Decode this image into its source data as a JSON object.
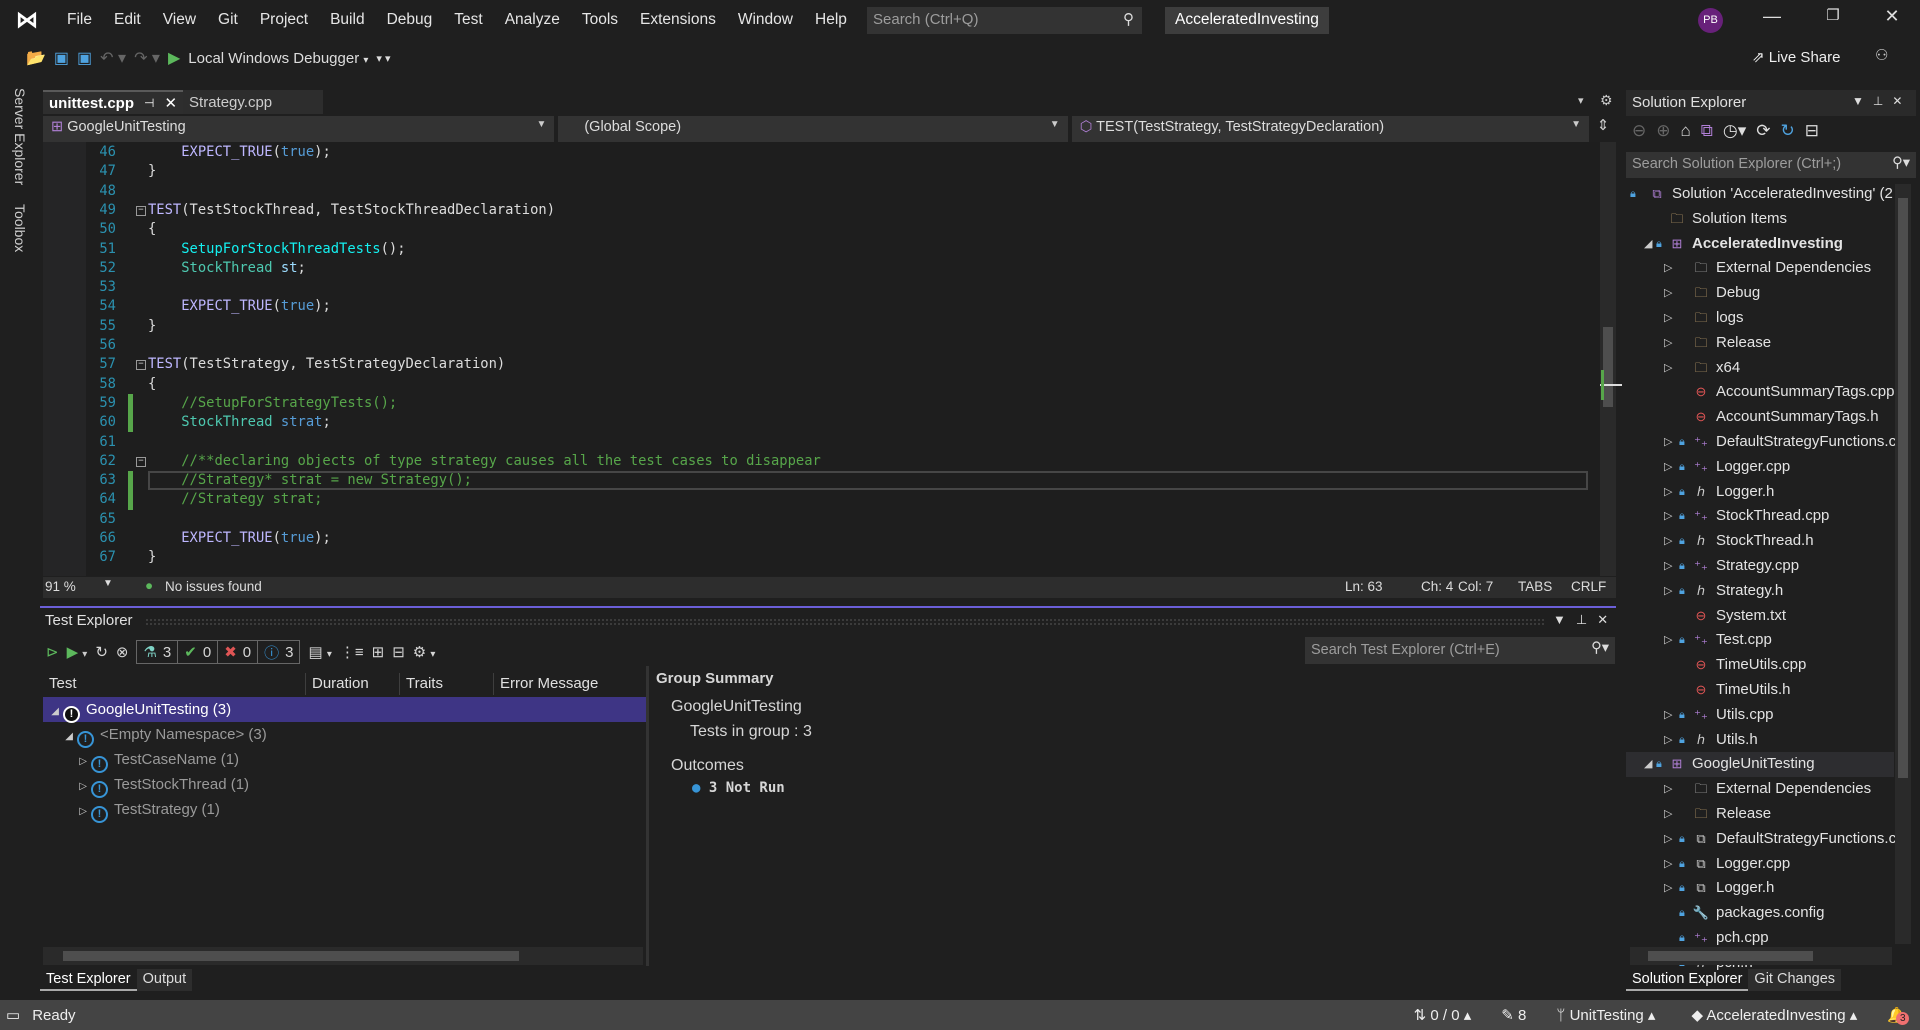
{
  "menu": {
    "items": [
      "File",
      "Edit",
      "View",
      "Git",
      "Project",
      "Build",
      "Debug",
      "Test",
      "Analyze",
      "Tools",
      "Extensions",
      "Window",
      "Help"
    ],
    "search_placeholder": "Search (Ctrl+Q)",
    "solution_name": "AcceleratedInvesting",
    "avatar": "PB"
  },
  "toolbar": {
    "debugger": "Local Windows Debugger",
    "live_share": "Live Share"
  },
  "side_tabs": [
    "Server Explorer",
    "Toolbox"
  ],
  "doc_tabs": [
    {
      "label": "unittest.cpp",
      "active": true
    },
    {
      "label": "Strategy.cpp",
      "active": false
    }
  ],
  "navbar": {
    "project": "GoogleUnitTesting",
    "scope": "(Global Scope)",
    "member": "TEST(TestStrategy, TestStrategyDeclaration)"
  },
  "code_lines": [
    {
      "n": "46",
      "segs": [
        [
          "mac",
          "    EXPECT_TRUE"
        ],
        [
          "p",
          "("
        ],
        [
          "kw",
          "true"
        ],
        [
          "p",
          ");"
        ]
      ]
    },
    {
      "n": "47",
      "segs": [
        [
          "p",
          "}"
        ]
      ]
    },
    {
      "n": "48",
      "segs": []
    },
    {
      "n": "49",
      "fold": true,
      "segs": [
        [
          "mac",
          "TEST"
        ],
        [
          "p",
          "(TestStockThread, TestStockThreadDeclaration)"
        ]
      ]
    },
    {
      "n": "50",
      "segs": [
        [
          "p",
          "{"
        ]
      ]
    },
    {
      "n": "51",
      "segs": [
        [
          "fn",
          "    SetupForStockThreadTests"
        ],
        [
          "p",
          "();"
        ]
      ]
    },
    {
      "n": "52",
      "segs": [
        [
          "ty",
          "    StockThread"
        ],
        [
          "p",
          " "
        ],
        [
          "var",
          "st"
        ],
        [
          "p",
          ";"
        ]
      ]
    },
    {
      "n": "53",
      "segs": []
    },
    {
      "n": "54",
      "segs": [
        [
          "mac",
          "    EXPECT_TRUE"
        ],
        [
          "p",
          "("
        ],
        [
          "kw",
          "true"
        ],
        [
          "p",
          ");"
        ]
      ]
    },
    {
      "n": "55",
      "segs": [
        [
          "p",
          "}"
        ]
      ]
    },
    {
      "n": "56",
      "segs": []
    },
    {
      "n": "57",
      "fold": true,
      "segs": [
        [
          "mac",
          "TEST"
        ],
        [
          "p",
          "(TestStrategy, TestStrategyDeclaration)"
        ]
      ]
    },
    {
      "n": "58",
      "segs": [
        [
          "p",
          "{"
        ]
      ]
    },
    {
      "n": "59",
      "changed": true,
      "segs": [
        [
          "cm",
          "    //SetupForStrategyTests();"
        ]
      ]
    },
    {
      "n": "60",
      "changed": true,
      "segs": [
        [
          "ty",
          "    StockThread"
        ],
        [
          "p",
          " "
        ],
        [
          "kw",
          "strat"
        ],
        [
          "p",
          ";"
        ]
      ]
    },
    {
      "n": "61",
      "segs": []
    },
    {
      "n": "62",
      "fold": true,
      "segs": [
        [
          "cm",
          "    //**declaring objects of type strategy causes all the test cases to disappear"
        ]
      ]
    },
    {
      "n": "63",
      "changed": true,
      "current": true,
      "segs": [
        [
          "cm",
          "    //Strategy* strat = new Strategy();"
        ]
      ]
    },
    {
      "n": "64",
      "changed": true,
      "segs": [
        [
          "cm",
          "    //Strategy strat;"
        ]
      ]
    },
    {
      "n": "65",
      "segs": []
    },
    {
      "n": "66",
      "segs": [
        [
          "mac",
          "    EXPECT_TRUE"
        ],
        [
          "p",
          "("
        ],
        [
          "kw",
          "true"
        ],
        [
          "p",
          ");"
        ]
      ]
    },
    {
      "n": "67",
      "segs": [
        [
          "p",
          "}"
        ]
      ]
    }
  ],
  "editor_status": {
    "zoom": "91 %",
    "issues": "No issues found",
    "ln": "Ln: 63",
    "ch": "Ch: 4",
    "col": "Col: 7",
    "tabs": "TABS",
    "eol": "CRLF"
  },
  "test_explorer": {
    "title": "Test Explorer",
    "counts": {
      "total": "3",
      "passed": "0",
      "failed": "0",
      "not_run": "3"
    },
    "search_placeholder": "Search Test Explorer (Ctrl+E)",
    "columns": [
      "Test",
      "Duration",
      "Traits",
      "Error Message"
    ],
    "rows": [
      {
        "label": "GoogleUnitTesting (3)",
        "level": 0,
        "expanded": true,
        "selected": true
      },
      {
        "label": "<Empty Namespace> (3)",
        "level": 1,
        "expanded": true
      },
      {
        "label": "TestCaseName (1)",
        "level": 2
      },
      {
        "label": "TestStockThread (1)",
        "level": 2
      },
      {
        "label": "TestStrategy (1)",
        "level": 2
      }
    ],
    "summary": {
      "heading": "Group Summary",
      "group": "GoogleUnitTesting",
      "tests_in_group": "Tests in group : 3",
      "outcomes": "Outcomes",
      "not_run": "3 Not  Run"
    }
  },
  "bottom_tabs_left": [
    "Test Explorer",
    "Output"
  ],
  "solution_explorer": {
    "title": "Solution Explorer",
    "search_placeholder": "Search Solution Explorer (Ctrl+;)",
    "items": [
      {
        "label": "Solution 'AcceleratedInvesting' (2",
        "lvl": 0,
        "lock": true,
        "icon": "sln"
      },
      {
        "label": "Solution Items",
        "lvl": 1,
        "icon": "folder"
      },
      {
        "label": "AcceleratedInvesting",
        "lvl": 1,
        "exp": "open",
        "lock": true,
        "icon": "proj",
        "bold": true
      },
      {
        "label": "External Dependencies",
        "lvl": 2,
        "exp": "closed",
        "icon": "extdep"
      },
      {
        "label": "Debug",
        "lvl": 2,
        "exp": "closed",
        "icon": "folder"
      },
      {
        "label": "logs",
        "lvl": 2,
        "exp": "closed",
        "icon": "folder"
      },
      {
        "label": "Release",
        "lvl": 2,
        "exp": "closed",
        "icon": "folder"
      },
      {
        "label": "x64",
        "lvl": 2,
        "exp": "closed",
        "icon": "folder"
      },
      {
        "label": "AccountSummaryTags.cpp",
        "lvl": 2,
        "icon": "missing"
      },
      {
        "label": "AccountSummaryTags.h",
        "lvl": 2,
        "icon": "missing"
      },
      {
        "label": "DefaultStrategyFunctions.c",
        "lvl": 2,
        "exp": "closed",
        "lock": true,
        "icon": "cpp"
      },
      {
        "label": "Logger.cpp",
        "lvl": 2,
        "exp": "closed",
        "lock": true,
        "icon": "cpp"
      },
      {
        "label": "Logger.h",
        "lvl": 2,
        "exp": "closed",
        "lock": true,
        "icon": "h"
      },
      {
        "label": "StockThread.cpp",
        "lvl": 2,
        "exp": "closed",
        "lock": true,
        "icon": "cpp"
      },
      {
        "label": "StockThread.h",
        "lvl": 2,
        "exp": "closed",
        "lock": true,
        "icon": "h"
      },
      {
        "label": "Strategy.cpp",
        "lvl": 2,
        "exp": "closed",
        "lock": true,
        "icon": "cpp"
      },
      {
        "label": "Strategy.h",
        "lvl": 2,
        "exp": "closed",
        "lock": true,
        "icon": "h"
      },
      {
        "label": "System.txt",
        "lvl": 2,
        "icon": "missing"
      },
      {
        "label": "Test.cpp",
        "lvl": 2,
        "exp": "closed",
        "lock": true,
        "icon": "cpp"
      },
      {
        "label": "TimeUtils.cpp",
        "lvl": 2,
        "icon": "missing"
      },
      {
        "label": "TimeUtils.h",
        "lvl": 2,
        "icon": "missing"
      },
      {
        "label": "Utils.cpp",
        "lvl": 2,
        "exp": "closed",
        "lock": true,
        "icon": "cpp"
      },
      {
        "label": "Utils.h",
        "lvl": 2,
        "exp": "closed",
        "lock": true,
        "icon": "h"
      },
      {
        "label": "GoogleUnitTesting",
        "lvl": 1,
        "exp": "open",
        "lock": true,
        "icon": "proj",
        "highlight": true
      },
      {
        "label": "External Dependencies",
        "lvl": 2,
        "exp": "closed",
        "icon": "extdep"
      },
      {
        "label": "Release",
        "lvl": 2,
        "exp": "closed",
        "icon": "folder"
      },
      {
        "label": "DefaultStrategyFunctions.c",
        "lvl": 2,
        "exp": "closed",
        "lock": true,
        "icon": "link"
      },
      {
        "label": "Logger.cpp",
        "lvl": 2,
        "exp": "closed",
        "lock": true,
        "icon": "link"
      },
      {
        "label": "Logger.h",
        "lvl": 2,
        "exp": "closed",
        "lock": true,
        "icon": "link"
      },
      {
        "label": "packages.config",
        "lvl": 2,
        "lock": true,
        "icon": "config"
      },
      {
        "label": "pch.cpp",
        "lvl": 2,
        "lock": true,
        "icon": "cpp"
      },
      {
        "label": "pch.h",
        "lvl": 2,
        "lock": true,
        "icon": "h"
      }
    ]
  },
  "bottom_tabs_right": [
    "Solution Explorer",
    "Git Changes"
  ],
  "status_bar": {
    "ready": "Ready",
    "sync": "0 / 0",
    "edits": "8",
    "branch": "UnitTesting",
    "repo": "AcceleratedInvesting",
    "notifications": "3"
  }
}
